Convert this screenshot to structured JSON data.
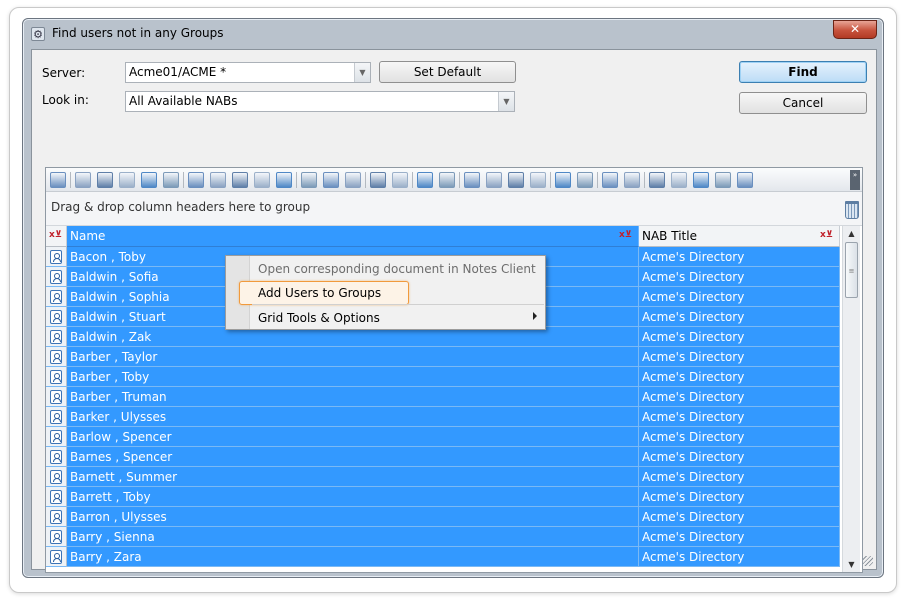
{
  "window": {
    "title": "Find users not in any Groups",
    "close_label": "✕"
  },
  "form": {
    "server_label": "Server:",
    "server_value": "Acme01/ACME *",
    "lookin_label": "Look in:",
    "lookin_value": "All Available NABs",
    "set_default_label": "Set Default",
    "find_label": "Find",
    "cancel_label": "Cancel"
  },
  "grid": {
    "group_hint": "Drag & drop column headers here to group",
    "columns": [
      "Name",
      "NAB Title"
    ],
    "rows": [
      {
        "name": "Bacon , Toby",
        "nab": "Acme's Directory"
      },
      {
        "name": "Baldwin , Sofia",
        "nab": "Acme's Directory"
      },
      {
        "name": "Baldwin , Sophia",
        "nab": "Acme's Directory"
      },
      {
        "name": "Baldwin , Stuart",
        "nab": "Acme's Directory"
      },
      {
        "name": "Baldwin , Zak",
        "nab": "Acme's Directory"
      },
      {
        "name": "Barber , Taylor",
        "nab": "Acme's Directory"
      },
      {
        "name": "Barber , Toby",
        "nab": "Acme's Directory"
      },
      {
        "name": "Barber , Truman",
        "nab": "Acme's Directory"
      },
      {
        "name": "Barker , Ulysses",
        "nab": "Acme's Directory"
      },
      {
        "name": "Barlow , Spencer",
        "nab": "Acme's Directory"
      },
      {
        "name": "Barnes , Spencer",
        "nab": "Acme's Directory"
      },
      {
        "name": "Barnett , Summer",
        "nab": "Acme's Directory"
      },
      {
        "name": "Barrett , Toby",
        "nab": "Acme's Directory"
      },
      {
        "name": "Barron , Ulysses",
        "nab": "Acme's Directory"
      },
      {
        "name": "Barry , Sienna",
        "nab": "Acme's Directory"
      },
      {
        "name": "Barry , Zara",
        "nab": "Acme's Directory"
      }
    ]
  },
  "context_menu": {
    "items": [
      {
        "label": "Open corresponding document in Notes Client",
        "enabled": false
      },
      {
        "label": "Add Users to Groups",
        "enabled": true,
        "highlighted": true
      },
      {
        "label": "Grid Tools & Options",
        "enabled": true,
        "submenu": true
      }
    ]
  },
  "toolbar": {
    "icons": [
      "grid-settings",
      "add-row",
      "delete-row",
      "move-up",
      "move-down",
      "merge",
      "split",
      "column-left",
      "column-center",
      "column-right",
      "select-all",
      "copy",
      "paste",
      "export",
      "import",
      "print",
      "layout-dropdown",
      "zoom-in",
      "zoom-out",
      "zoom-reset",
      "filter",
      "folder-dropdown",
      "expand",
      "collapse",
      "group",
      "ungroup",
      "columns",
      "chart",
      "tag",
      "hierarchy",
      "tree"
    ]
  },
  "colors": {
    "selection": "#3399ff",
    "highlight_border": "#f19a3c"
  }
}
